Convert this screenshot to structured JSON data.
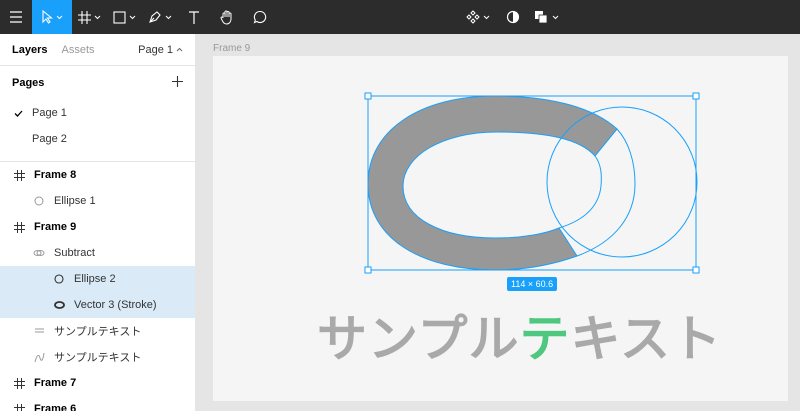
{
  "panel": {
    "tabs": [
      "Layers",
      "Assets"
    ],
    "page_selector": "Page 1",
    "pages_title": "Pages",
    "add_page_symbol": "+",
    "pages": [
      "Page 1",
      "Page 2"
    ],
    "layers": [
      {
        "label": "Frame 8",
        "kind": "frame",
        "depth": 0,
        "icon": "frame-icon"
      },
      {
        "label": "Ellipse 1",
        "kind": "ellipse",
        "depth": 1,
        "icon": "ellipse-icon"
      },
      {
        "label": "Frame 9",
        "kind": "frame",
        "depth": 0,
        "icon": "frame-icon"
      },
      {
        "label": "Subtract",
        "kind": "boolean",
        "depth": 1,
        "icon": "subtract-icon"
      },
      {
        "label": "Ellipse 2",
        "kind": "ellipse",
        "depth": 2,
        "icon": "ellipse-icon"
      },
      {
        "label": "Vector 3 (Stroke)",
        "kind": "vector",
        "depth": 2,
        "icon": "vector-stroke-icon"
      },
      {
        "label": "サンプルテキスト",
        "kind": "text",
        "depth": 1,
        "icon": "text-layer-icon"
      },
      {
        "label": "サンプルテキスト",
        "kind": "path",
        "depth": 1,
        "icon": "vector-path-icon"
      },
      {
        "label": "Frame 7",
        "kind": "frame",
        "depth": 0,
        "icon": "frame-icon"
      },
      {
        "label": "Frame 6",
        "kind": "frame",
        "depth": 0,
        "icon": "frame-icon"
      }
    ]
  },
  "canvas": {
    "frame_label": "Frame 9",
    "size_badge": "114 × 60.6",
    "text_main": "サンプル",
    "text_accent": "テ",
    "text_tail": "キスト"
  },
  "colors": {
    "toolbar_bg": "#2c2c2c",
    "accent_blue": "#18a0fb",
    "selected_layer_bg": "#daebf7",
    "shape_gray": "#989898",
    "text_gray": "#a9a9a9",
    "text_accent_green": "#4ec77f"
  }
}
